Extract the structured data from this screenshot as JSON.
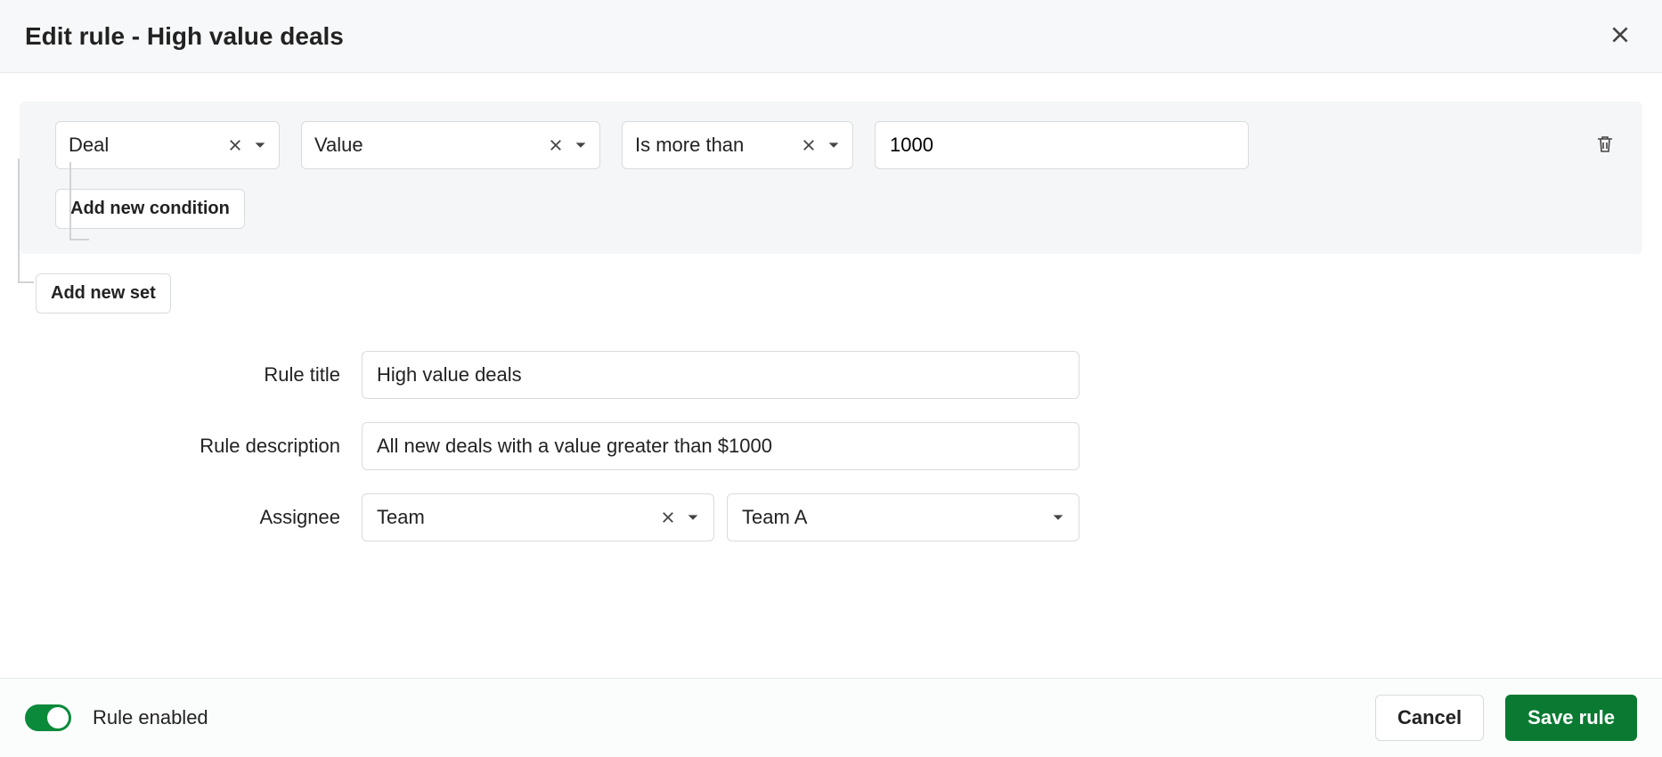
{
  "header": {
    "title": "Edit rule - High value deals"
  },
  "condition_set": {
    "conditions": [
      {
        "entity": "Deal",
        "field": "Value",
        "operator": "Is more than",
        "value": "1000"
      }
    ],
    "add_condition_label": "Add new condition"
  },
  "add_set_label": "Add new set",
  "form": {
    "title_label": "Rule title",
    "title_value": "High value deals",
    "description_label": "Rule description",
    "description_value": "All new deals with a value greater than $1000",
    "assignee_label": "Assignee",
    "assignee_type": "Team",
    "assignee_value": "Team A"
  },
  "footer": {
    "enabled": true,
    "enabled_label": "Rule enabled",
    "cancel_label": "Cancel",
    "save_label": "Save rule"
  }
}
